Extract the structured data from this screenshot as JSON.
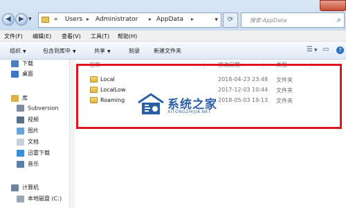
{
  "address": {
    "overflow": "«",
    "crumbs": [
      "Users",
      "Administrator",
      "AppData"
    ],
    "search_placeholder": "搜索 AppData"
  },
  "menu": [
    "文件(F)",
    "编辑(E)",
    "查看(V)",
    "工具(T)",
    "帮助(H)"
  ],
  "toolbar": {
    "organize": "组织",
    "include_library": "包含到库中",
    "share": "共享",
    "burn": "刻录",
    "new_folder": "新建文件夹"
  },
  "nav": {
    "downloads": "下载",
    "desktop": "桌面",
    "libraries": "库",
    "subversion": "Subversion",
    "videos": "视频",
    "pictures": "图片",
    "documents": "文档",
    "xunlei": "迅雷下载",
    "music": "音乐",
    "computer": "计算机",
    "local_disk": "本地磁盘 (C:)"
  },
  "columns": {
    "name": "名称",
    "date_modified": "修改日期",
    "type": "类型"
  },
  "files": [
    {
      "name": "Local",
      "date": "2018-04-23 23:48",
      "type": "文件夹"
    },
    {
      "name": "LocalLow",
      "date": "2017-12-03 10:44",
      "type": "文件夹"
    },
    {
      "name": "Roaming",
      "date": "2018-05-03 19:13",
      "type": "文件夹"
    }
  ],
  "watermark": {
    "title": "系统之家",
    "subtitle": "XITONGZHIJIA.NET"
  },
  "colors": {
    "highlight": "#e0141e",
    "folder": "#e0b23c",
    "watermark": "#2b5fa8"
  }
}
